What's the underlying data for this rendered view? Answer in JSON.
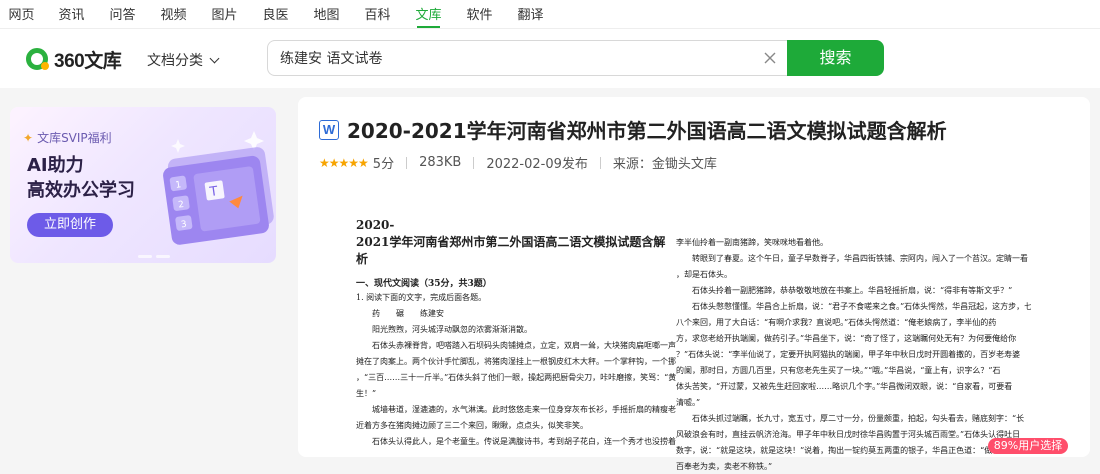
{
  "topnav": {
    "items": [
      {
        "label": "网页"
      },
      {
        "label": "资讯"
      },
      {
        "label": "问答"
      },
      {
        "label": "视频"
      },
      {
        "label": "图片"
      },
      {
        "label": "良医"
      },
      {
        "label": "地图"
      },
      {
        "label": "百科"
      },
      {
        "label": "文库",
        "active": true
      },
      {
        "label": "软件"
      },
      {
        "label": "翻译"
      }
    ]
  },
  "header": {
    "logo_text": "360文库",
    "category_label": "文档分类",
    "search_value": "练建安 语文试卷",
    "search_button": "搜索"
  },
  "promo": {
    "tag": "文库SVIP福利",
    "title_line1": "AI助力",
    "title_line2": "高效办公学习",
    "cta": "立即创作"
  },
  "doc": {
    "type_icon": "W",
    "title": "2020-2021学年河南省郑州市第二外国语高二语文模拟试题含解析",
    "score": "5分",
    "size": "283KB",
    "date": "2022-02-09发布",
    "source": "来源：金锄头文库"
  },
  "page_left": {
    "title_line1": "2020-",
    "title_line2": "2021学年河南省郑州市第二外国语高二语文模拟试题含解析",
    "section": "一、现代文阅读（35分，共3题）",
    "lines": [
      "1. 阅读下面的文字，完成后面各题。",
      "药　　碾　　练建安",
      "阳光煦煦，河头城浮动飘忽的浓雾渐渐消散。",
      "石体头赤裸脊背，吧嗒踏入石坝码头肉铺摊点，立定，双肩一耸，大块猪肉扁哐啷一声撼响，平",
      "摊在了肉案上。两个伙计手忙脚乱，将猪肉湿挂上一根钢皮红木大秤。一个掌秤钩，一个挪秤砣报数",
      "，“三百……三十一斤半。”石体头斜了他们一眼，操起两把厨骨尖刀，咔咔磨擦，笑骂：“黄疸后",
      "生！”",
      "城墙巷道，湿漉漉的，水气淋漓。此时悠悠走来一位身穿灰布长衫，手摇折扇的精瘦老人。他",
      "近着方多在猪肉摊边顾了三二个来回，瞅瞅，点点头，似笑非笑。",
      "石体头认得此人，是个老童生。传说是满腹诗书，考到胡子花白，连一个秀才也没捞着。长衫洗"
    ]
  },
  "page_right": {
    "lines": [
      "李半仙拎着一副南猪蹄，笑咪咪地看着他。",
      "转眼到了春夏。这个午日，童子早数脊子，华昌四街铁铺、宗阿内，闯入了一个苔汉。定睛一看",
      "，却是石体头。",
      "石体头拎着一副肥猪蹄，恭恭敬敬地放在书案上。华昌轻摇折扇，说：“得非有等斯文乎？”",
      "石体头憋憋懂懂。华昌合上折扇，说：“君子不食嗟来之食。”石体头愕然，华昌冠起，这方步，七",
      "八个来回，用了大白话：“有啊介求我？直说吧。”石体头愕然道：“俺老娘病了，李半仙的药",
      "方，求您老给开执端阑，做药引子。”华昌坐下，说：“奇了怪了，这端瞩何处无有？为何要俺给你",
      "？”石体头说：“李半仙说了，定要开执阿猫执的端阑，甲子年中秋日戊时开圆着撒的，百岁老寿婆",
      "的阑，那时日，方圆几百里，只有您老先生买了一块。”“哦。”华昌说，“童上有，识字么？”石",
      "体头苦笑，“开过蒙，又被先生赶回家啦……略识几个字。”华昌微闭双眼，说：“自家看，可要看",
      "清嘘。”",
      "石体头抓过端瞩，长九寸，宽五寸，厚二寸一分，份量颇重，拍起，勾头看去，赌底刻字：“长",
      "风破浪会有时，直挂云帆济沧海。甲子年中秋日戊时徐华昌购置于河头城百雨堂。”石体头认得吐日",
      "数字，说：“就是这块，就是这块！”说着，掏出一锭约莫五两重的银子，华昌正色道：“做嘛介？",
      "百奉老为卖，卖老不称铁。”"
    ]
  },
  "badge": "89%用户选择"
}
